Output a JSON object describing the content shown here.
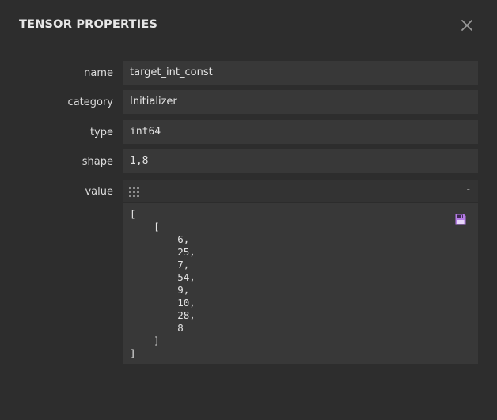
{
  "dialog": {
    "title": "TENSOR PROPERTIES",
    "close_icon": "close-icon"
  },
  "properties": {
    "name_label": "name",
    "name_value": "target_int_const",
    "category_label": "category",
    "category_value": "Initializer",
    "type_label": "type",
    "type_value": "int64",
    "shape_label": "shape",
    "shape_value": "1,8",
    "value_label": "value"
  },
  "value_panel": {
    "collapse_label": "-",
    "grip_icon": "grip-icon",
    "save_icon": "save-icon",
    "text": "[\n    [\n        6,\n        25,\n        7,\n        54,\n        9,\n        10,\n        28,\n        8\n    ]\n]"
  },
  "colors": {
    "background": "#2d2d2d",
    "field_background": "#383838",
    "save_icon": "#b57be6"
  }
}
